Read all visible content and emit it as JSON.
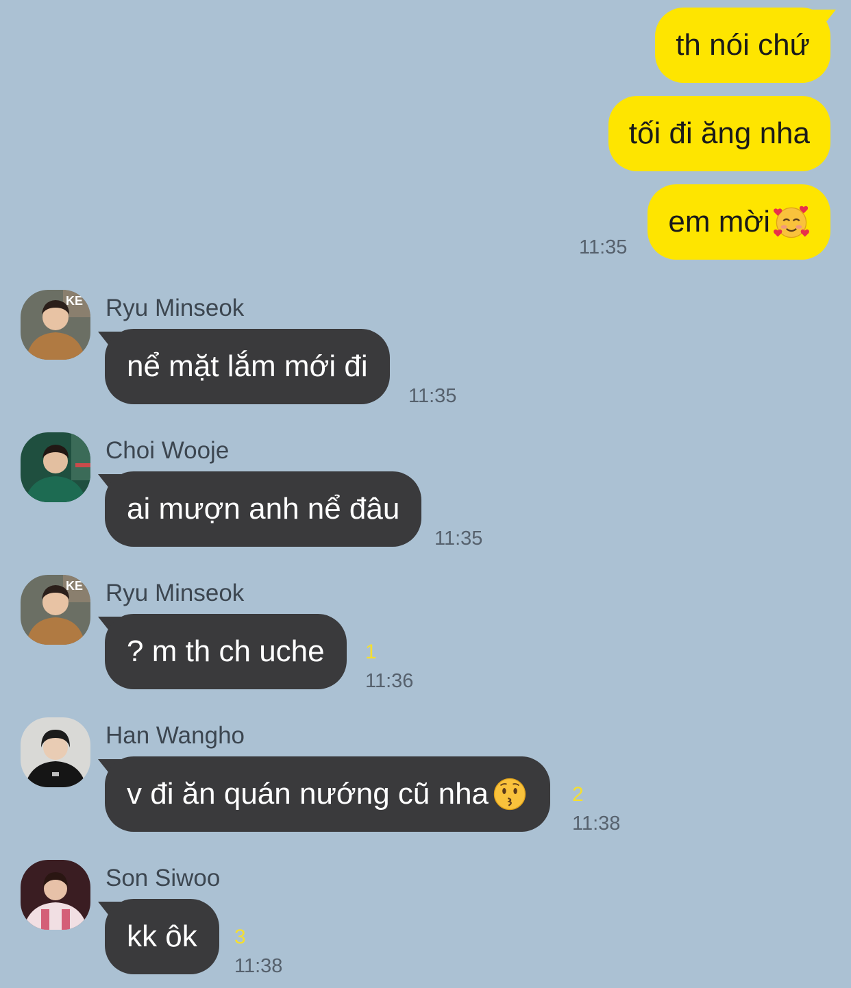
{
  "colors": {
    "background": "#abc1d3",
    "outgoing_bubble": "#fee500",
    "incoming_bubble": "#3a3a3c",
    "unread_count": "#f5df2e"
  },
  "outgoing": [
    {
      "text": "th nói chứ"
    },
    {
      "text": "tối đi ăng nha"
    },
    {
      "text": "em mời",
      "emoji": "smiling-face-with-hearts-emoji",
      "time": "11:35"
    }
  ],
  "incoming": [
    {
      "sender": "Ryu Minseok",
      "avatar": "avatar-ryu-minseok",
      "text": "nể mặt lắm mới đi",
      "time": "11:35"
    },
    {
      "sender": "Choi Wooje",
      "avatar": "avatar-choi-wooje",
      "text": "ai mượn anh nể đâu",
      "time": "11:35"
    },
    {
      "sender": "Ryu Minseok",
      "avatar": "avatar-ryu-minseok",
      "text": "? m th ch uche",
      "unread": "1",
      "time": "11:36"
    },
    {
      "sender": "Han Wangho",
      "avatar": "avatar-han-wangho",
      "text": "v đi ăn quán nướng cũ nha",
      "emoji": "kissing-face-emoji",
      "unread": "2",
      "time": "11:38"
    },
    {
      "sender": "Son Siwoo",
      "avatar": "avatar-son-siwoo",
      "text": "kk ôk",
      "unread": "3",
      "time": "11:38"
    }
  ]
}
